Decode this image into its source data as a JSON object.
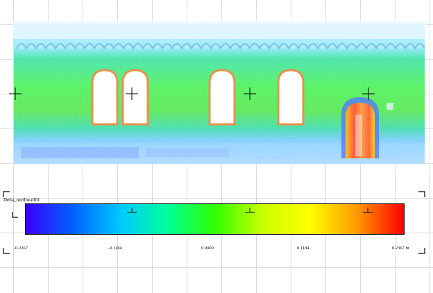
{
  "legend": {
    "title": "Delta_northwall01",
    "ticks": [
      "-0.2367",
      "-0.1184",
      "0.0000",
      "0.1184",
      "0.2367 m"
    ],
    "min": -0.2367,
    "max": 0.2367,
    "unit": "m"
  },
  "colormap": [
    "#3a00ff",
    "#0060ff",
    "#00c8ff",
    "#00ff9a",
    "#2eff00",
    "#c8ff00",
    "#ffff00",
    "#ff9a00",
    "#ff0000"
  ],
  "scan": {
    "base_color": "#3ee24e",
    "window_outline": "#e07a2a",
    "door_hot": "#ff3a1a",
    "low_blue": "#3060ff"
  },
  "markers": [
    "crosshair-marker",
    "crosshair-marker",
    "crosshair-marker",
    "crosshair-marker"
  ]
}
